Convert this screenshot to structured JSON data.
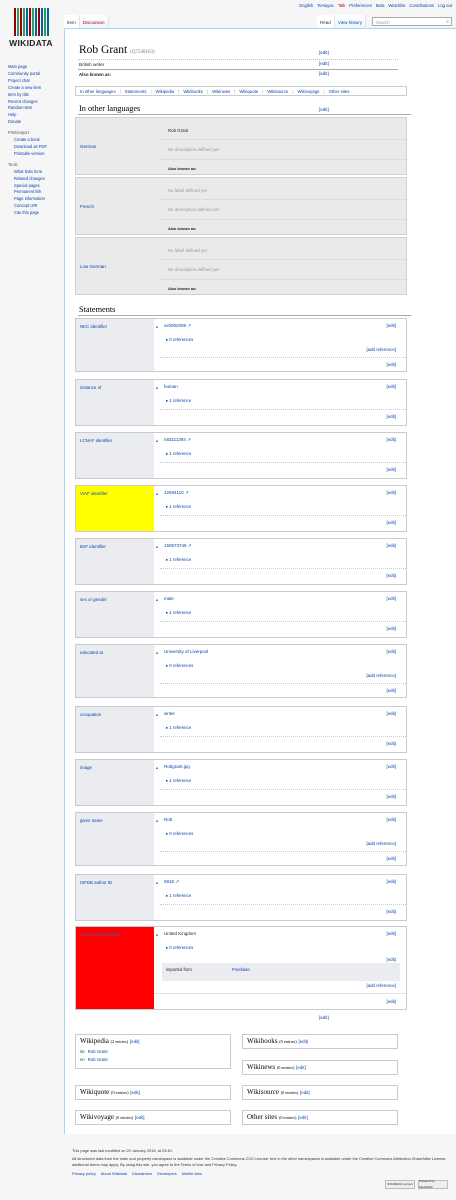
{
  "personal": {
    "language": "English",
    "user": "Tomayac",
    "talk": "Talk",
    "preferences": "Preferences",
    "beta": "Beta",
    "watchlist": "Watchlist",
    "contributions": "Contributions",
    "logout": "Log out"
  },
  "logo": {
    "text": "WIKIDATA",
    "bar_colors": [
      "#990000",
      "#339966",
      "#990000",
      "#339966",
      "#006699",
      "#990000",
      "#339966",
      "#006699",
      "#990000",
      "#006699",
      "#339966",
      "#006699"
    ]
  },
  "tabs": {
    "item": "Item",
    "discussion": "Discussion",
    "read": "Read",
    "history": "View history"
  },
  "search": {
    "placeholder": "Search"
  },
  "sidebar": {
    "items": [
      "Main page",
      "Community portal",
      "Project chat",
      "Create a new item",
      "Item by title",
      "Recent changes",
      "Random item",
      "Help",
      "Donate"
    ],
    "print_head": "Print/export",
    "print_items": [
      "Create a book",
      "Download as PDF",
      "Printable version"
    ],
    "tools_head": "Tools",
    "tools_items": [
      "What links here",
      "Related changes",
      "Special pages",
      "Permanent link",
      "Page information",
      "Concept URI",
      "Cite this page"
    ]
  },
  "item": {
    "label": "Rob Grant",
    "qid": "(Q7340163)",
    "description": "British writer",
    "aka_label": "Also known as:",
    "edit": "[edit]"
  },
  "toc": [
    "In other languages",
    "Statements",
    "Wikipedia",
    "Wikibooks",
    "Wikinews",
    "Wikiquote",
    "Wikisource",
    "Wikivoyage",
    "Other sites"
  ],
  "languages_heading": "In other languages",
  "languages": [
    {
      "name": "German",
      "label": "Rob Grant",
      "description": "No description defined yet",
      "aka": "Also known as:"
    },
    {
      "name": "French",
      "label": "No label defined yet",
      "description": "No description defined yet",
      "aka": "Also known as:"
    },
    {
      "name": "Low German",
      "label": "No label defined yet",
      "description": "No description defined yet",
      "aka": "Also known as:"
    }
  ],
  "statements_heading": "Statements",
  "statements": [
    {
      "property": "NKC identifier",
      "value": "xx0002008",
      "refs": "0 references",
      "add_ref": "[add reference]"
    },
    {
      "property": "instance of",
      "value": "human",
      "refs": "1 reference"
    },
    {
      "property": "LCNAF identifier",
      "value": "n83111394",
      "refs": "1 reference"
    },
    {
      "property": "VIAF identifier",
      "value": "12584110",
      "refs": "1 reference",
      "highlight": "#ffff00"
    },
    {
      "property": "BnF identifier",
      "value": "150673745",
      "refs": "1 reference"
    },
    {
      "property": "sex or gender",
      "value": "male",
      "refs": "1 reference"
    },
    {
      "property": "educated at",
      "value": "University of Liverpool",
      "refs": "0 references",
      "add_ref": "[add reference]"
    },
    {
      "property": "occupation",
      "value": "writer",
      "refs": "1 reference"
    },
    {
      "property": "image",
      "value": "Robgrant.jpg",
      "refs": "1 reference"
    },
    {
      "property": "given name",
      "value": "Rob",
      "refs": "0 references",
      "add_ref": "[add reference]"
    },
    {
      "property": "ISFDB author ID",
      "value": "5815",
      "refs": "1 reference"
    },
    {
      "property": "country of citizenship",
      "value": "United Kingdom",
      "refs": "0 references",
      "imported_from": "imported from",
      "imported_value": "Freebase",
      "add_ref": "[add reference]",
      "highlight": "#ff0000"
    }
  ],
  "sites": {
    "wikipedia": {
      "title": "Wikipedia",
      "count": "(2 entries)",
      "links": [
        {
          "lang": "de",
          "title": "Rob Grant"
        },
        {
          "lang": "en",
          "title": "Rob Grant"
        }
      ]
    },
    "wikibooks": {
      "title": "Wikibooks",
      "count": "(0 entries)"
    },
    "wikinews": {
      "title": "Wikinews",
      "count": "(0 entries)"
    },
    "wikiquote": {
      "title": "Wikiquote",
      "count": "(0 entries)"
    },
    "wikisource": {
      "title": "Wikisource",
      "count": "(0 entries)"
    },
    "wikivoyage": {
      "title": "Wikivoyage",
      "count": "(0 entries)"
    },
    "other": {
      "title": "Other sites",
      "count": "(0 entries)"
    }
  },
  "footer": {
    "modified": "This page was last modified on 20 January 2015, at 23:40.",
    "license": "All structured data from the main and property namespace is available under the Creative Commons CC0 License; text in the other namespaces is available under the Creative Commons Attribution-ShareAlike License; additional terms may apply. By using this site, you agree to the Terms of Use and Privacy Policy.",
    "links": [
      "Privacy policy",
      "About Wikidata",
      "Disclaimers",
      "Developers",
      "Mobile view"
    ],
    "badge1": "WIKIMEDIA project",
    "badge2": "Powered by MediaWiki"
  }
}
